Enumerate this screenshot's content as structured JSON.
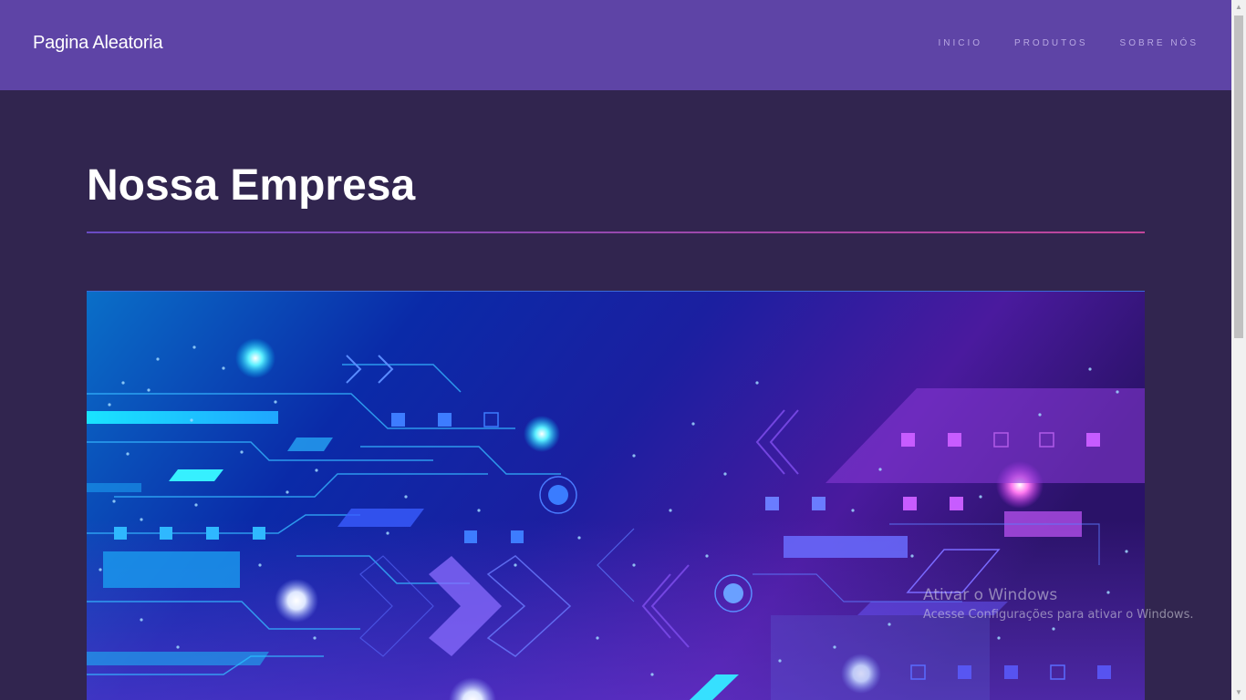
{
  "header": {
    "brand": "Pagina Aleatoria",
    "nav": [
      "INICIO",
      "PRODUTOS",
      "SOBRE NÓS"
    ]
  },
  "main": {
    "title": "Nossa Empresa"
  },
  "hero": {
    "icon": "tech-circuit-illustration"
  },
  "watermark": {
    "title": "Ativar o Windows",
    "subtitle": "Acesse Configurações para ativar o Windows."
  },
  "colors": {
    "header_bg": "#5e44a6",
    "page_bg": "#31254f",
    "accent": "#c2459a"
  }
}
